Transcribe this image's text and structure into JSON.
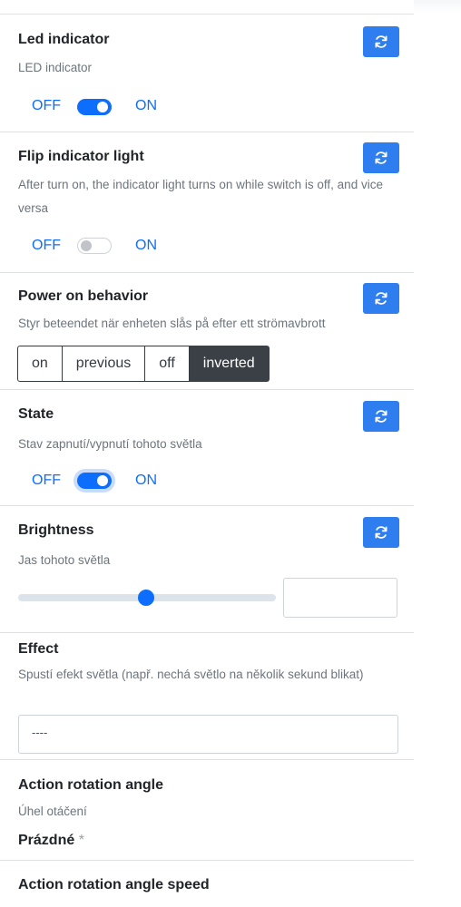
{
  "toggle_labels": {
    "off": "OFF",
    "on": "ON"
  },
  "colors": {
    "accent": "#0d6efd",
    "refresh_button": "#2f7ef0",
    "active_option": "#3a4046"
  },
  "sections": {
    "led_indicator": {
      "title": "Led indicator",
      "description": "LED indicator",
      "switch_state": "on",
      "refresh_icon": "refresh-icon"
    },
    "flip_indicator": {
      "title": "Flip indicator light",
      "description": "After turn on, the indicator light turns on while switch is off, and vice versa",
      "switch_state": "off",
      "refresh_icon": "refresh-icon"
    },
    "power_on_behavior": {
      "title": "Power on behavior",
      "description": "Styr beteendet när enheten slås på efter ett strömavbrott",
      "options": [
        "on",
        "previous",
        "off",
        "inverted"
      ],
      "selected": "inverted",
      "refresh_icon": "refresh-icon"
    },
    "state": {
      "title": "State",
      "description": "Stav zapnutí/vypnutí tohoto světla",
      "switch_state": "on",
      "refresh_icon": "refresh-icon"
    },
    "brightness": {
      "title": "Brightness",
      "description": "Jas tohoto světla",
      "slider_value_fraction": 0.52,
      "value": "",
      "refresh_icon": "refresh-icon"
    },
    "effect": {
      "title": "Effect",
      "description": "Spustí efekt světla (např. nechá světlo na několik sekund blikat)",
      "selected_value": "----"
    },
    "action_rotation_angle": {
      "title": "Action rotation angle",
      "description": "Úhel otáčení",
      "value": "Prázdné",
      "required_mark": "*"
    },
    "action_rotation_angle_speed": {
      "title": "Action rotation angle speed"
    }
  }
}
